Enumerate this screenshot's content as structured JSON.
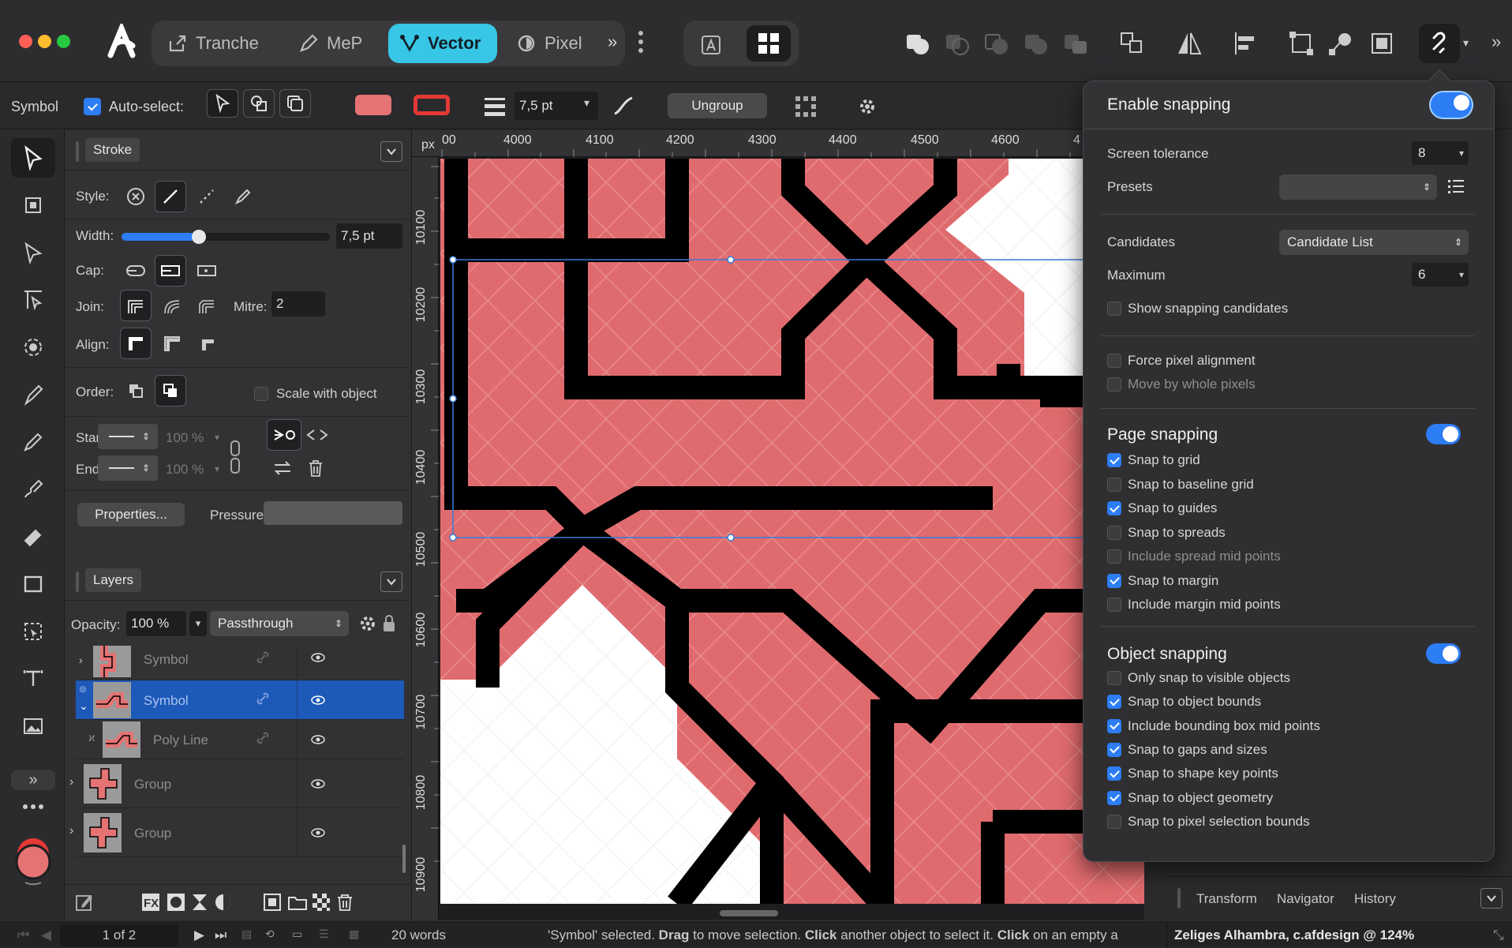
{
  "app": {
    "personas": [
      {
        "label": "Tranche",
        "icon": "export-icon"
      },
      {
        "label": "MeP",
        "icon": "pen-icon"
      },
      {
        "label": "Vector",
        "icon": "vector-icon"
      },
      {
        "label": "Pixel",
        "icon": "pixel-icon"
      }
    ],
    "active_persona": "Vector"
  },
  "context": {
    "object_type": "Symbol",
    "auto_select_label": "Auto-select:",
    "auto_select_checked": true,
    "fill_color": "#e57373",
    "stroke_color": "#e53935",
    "stroke_width": "7,5 pt",
    "ungroup_label": "Ungroup"
  },
  "stroke_panel": {
    "tab": "Stroke",
    "style_label": "Style:",
    "width_label": "Width:",
    "width_value": "7,5 pt",
    "width_fraction": 0.37,
    "cap_label": "Cap:",
    "join_label": "Join:",
    "mitre_label": "Mitre:",
    "mitre_value": "2",
    "align_label": "Align:",
    "order_label": "Order:",
    "scale_label": "Scale with object",
    "start_label": "Start:",
    "end_label": "End:",
    "start_pct": "100 %",
    "end_pct": "100 %",
    "properties_label": "Properties...",
    "pressure_label": "Pressure:"
  },
  "layers_panel": {
    "tab": "Layers",
    "opacity_label": "Opacity:",
    "opacity_value": "100 %",
    "blend_mode": "Passthrough",
    "rows": [
      {
        "name": "Symbol",
        "selected": false
      },
      {
        "name": "Symbol",
        "selected": true
      },
      {
        "name": "Poly Line",
        "selected": false
      },
      {
        "name": "Group",
        "selected": false
      },
      {
        "name": "Group",
        "selected": false
      }
    ]
  },
  "ruler": {
    "unit": "px",
    "h_ticks": [
      "00",
      "4000",
      "4100",
      "4200",
      "4300",
      "4400",
      "4500",
      "4600",
      "4"
    ],
    "v_ticks": [
      "10100",
      "10200",
      "10300",
      "10400",
      "10500",
      "10600",
      "10700",
      "10800",
      "10900"
    ]
  },
  "snapping": {
    "enable_label": "Enable snapping",
    "enabled": true,
    "screen_tolerance_label": "Screen tolerance",
    "screen_tolerance": "8",
    "presets_label": "Presets",
    "candidates_label": "Candidates",
    "candidates_value": "Candidate List",
    "maximum_label": "Maximum",
    "maximum_value": "6",
    "show_candidates": {
      "label": "Show snapping candidates",
      "checked": false
    },
    "force_pixel": {
      "label": "Force pixel alignment",
      "checked": false
    },
    "move_whole": {
      "label": "Move by whole pixels",
      "checked": false
    },
    "page_title": "Page snapping",
    "page_enabled": true,
    "page_items": [
      {
        "label": "Snap to grid",
        "checked": true,
        "dim": false
      },
      {
        "label": "Snap to baseline grid",
        "checked": false,
        "dim": false
      },
      {
        "label": "Snap to guides",
        "checked": true,
        "dim": false
      },
      {
        "label": "Snap to spreads",
        "checked": false,
        "dim": false
      },
      {
        "label": "Include spread mid points",
        "checked": false,
        "dim": true
      },
      {
        "label": "Snap to margin",
        "checked": true,
        "dim": false
      },
      {
        "label": "Include margin mid points",
        "checked": false,
        "dim": false
      }
    ],
    "object_title": "Object snapping",
    "object_enabled": true,
    "object_items": [
      {
        "label": "Only snap to visible objects",
        "checked": false
      },
      {
        "label": "Snap to object bounds",
        "checked": true
      },
      {
        "label": "Include bounding box mid points",
        "checked": true
      },
      {
        "label": "Snap to gaps and sizes",
        "checked": true
      },
      {
        "label": "Snap to shape key points",
        "checked": true
      },
      {
        "label": "Snap to object geometry",
        "checked": true
      },
      {
        "label": "Snap to pixel selection bounds",
        "checked": false
      }
    ]
  },
  "right_panel_tabs": [
    "Transform",
    "Navigator",
    "History"
  ],
  "status": {
    "page": "1 of 2",
    "words": "20 words",
    "hint_parts": [
      {
        "text": "'Symbol' selected. ",
        "bold": false
      },
      {
        "text": "Drag",
        "bold": true
      },
      {
        "text": " to move selection. ",
        "bold": false
      },
      {
        "text": "Click",
        "bold": true
      },
      {
        "text": " another object to select it. ",
        "bold": false
      },
      {
        "text": "Click",
        "bold": true
      },
      {
        "text": " on an empty a",
        "bold": false
      }
    ],
    "document": "Zeliges Alhambra, c.afdesign @ 124%"
  }
}
